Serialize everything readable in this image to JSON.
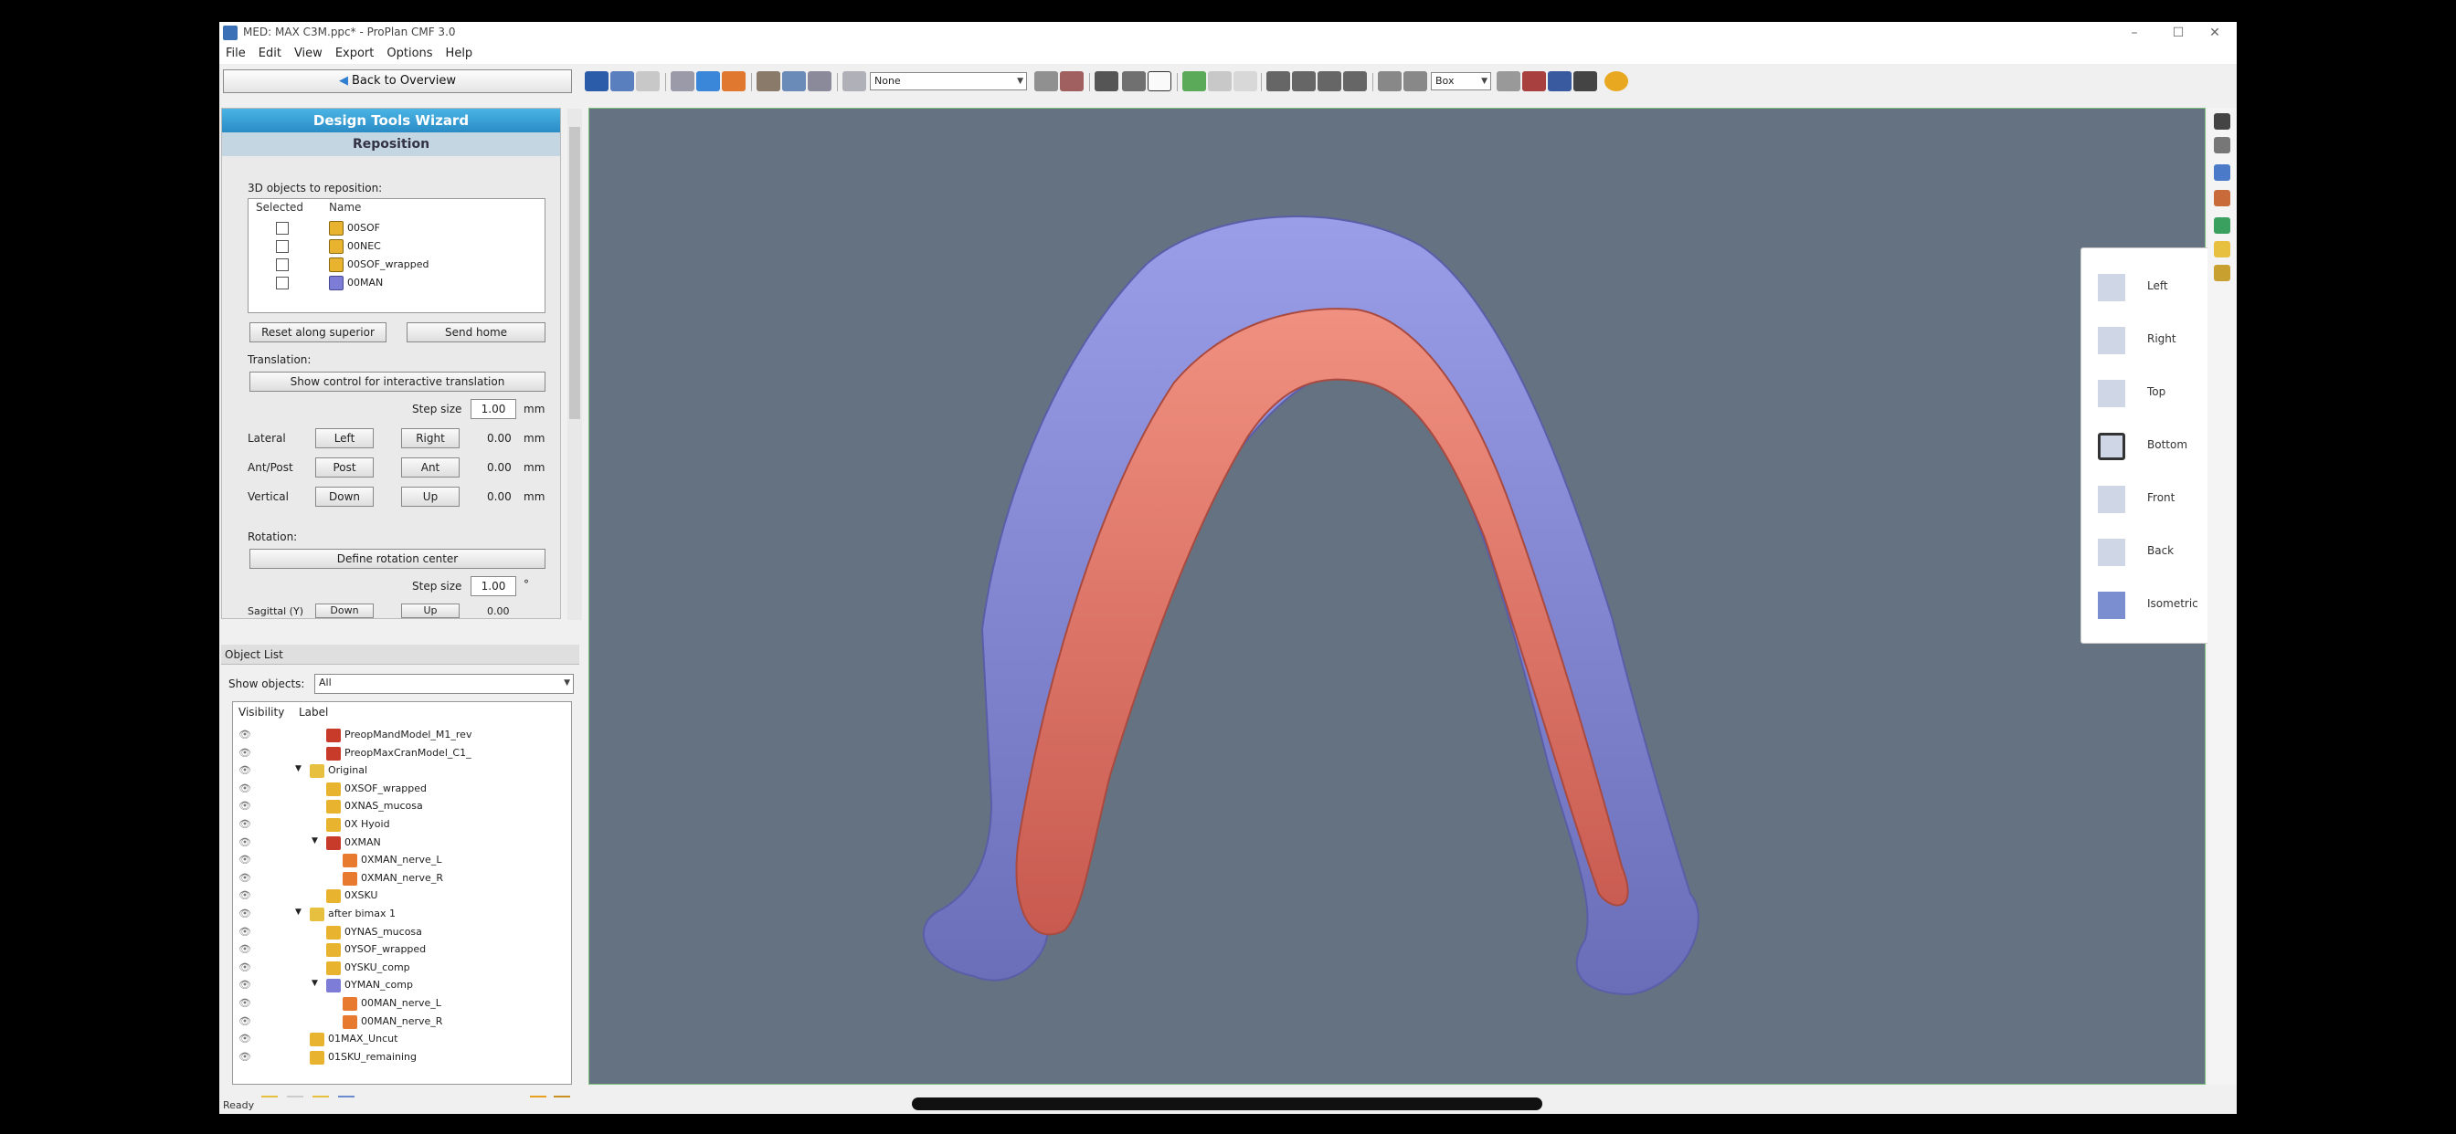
{
  "window": {
    "title": "MED: MAX C3M.ppc* - ProPlan CMF 3.0"
  },
  "menu": [
    "File",
    "Edit",
    "View",
    "Export",
    "Options",
    "Help"
  ],
  "back_button": "Back to Overview",
  "toolbar": {
    "combo_none": "None",
    "combo_box": "Box"
  },
  "wizard": {
    "title": "Design Tools Wizard",
    "subtitle": "Reposition",
    "objects_label": "3D objects to reposition:",
    "col_selected": "Selected",
    "col_name": "Name",
    "objects": [
      "00SOF",
      "00NEC",
      "00SOF_wrapped",
      "00MAN"
    ],
    "reset_button": "Reset along superior",
    "send_home_button": "Send home",
    "translation_label": "Translation:",
    "show_control_button": "Show control for interactive translation",
    "step_label": "Step size",
    "step_value": "1.00",
    "unit_mm": "mm",
    "rows": [
      {
        "label": "Lateral",
        "b1": "Left",
        "b2": "Right",
        "val": "0.00"
      },
      {
        "label": "Ant/Post",
        "b1": "Post",
        "b2": "Ant",
        "val": "0.00"
      },
      {
        "label": "Vertical",
        "b1": "Down",
        "b2": "Up",
        "val": "0.00"
      }
    ],
    "rotation_label": "Rotation:",
    "define_center_button": "Define rotation center",
    "rot_step_value": "1.00",
    "unit_deg": "°",
    "cut_label": "Sagittal (Y)",
    "cut_b1": "Down",
    "cut_b2": "Up",
    "cut_val": "0.00"
  },
  "object_list": {
    "title": "Object List",
    "show_label": "Show objects:",
    "show_value": "All",
    "col_visibility": "Visibility",
    "col_label": "Label",
    "items": [
      {
        "label": "PreopMandModel_M1_rev",
        "color": "#c83a2a",
        "indent": 2
      },
      {
        "label": "PreopMaxCranModel_C1_",
        "color": "#c83a2a",
        "indent": 2
      },
      {
        "label": "Original",
        "color": "#e8c040",
        "indent": 1,
        "folder": true
      },
      {
        "label": "0XSOF_wrapped",
        "color": "#e8b430",
        "indent": 2
      },
      {
        "label": "0XNAS_mucosa",
        "color": "#e8b430",
        "indent": 2
      },
      {
        "label": "0X Hyoid",
        "color": "#e8b430",
        "indent": 2
      },
      {
        "label": "0XMAN",
        "color": "#c83a2a",
        "indent": 2,
        "expanded": true
      },
      {
        "label": "0XMAN_nerve_L",
        "color": "#e87a30",
        "indent": 3
      },
      {
        "label": "0XMAN_nerve_R",
        "color": "#e87a30",
        "indent": 3
      },
      {
        "label": "0XSKU",
        "color": "#e8b430",
        "indent": 2
      },
      {
        "label": "after bimax 1",
        "color": "#e8c040",
        "indent": 1,
        "folder": true
      },
      {
        "label": "0YNAS_mucosa",
        "color": "#e8b430",
        "indent": 2
      },
      {
        "label": "0YSOF_wrapped",
        "color": "#e8b430",
        "indent": 2
      },
      {
        "label": "0YSKU_comp",
        "color": "#e8b430",
        "indent": 2
      },
      {
        "label": "0YMAN_comp",
        "color": "#7d7dd8",
        "indent": 2,
        "expanded": true
      },
      {
        "label": "00MAN_nerve_L",
        "color": "#e87a30",
        "indent": 3
      },
      {
        "label": "00MAN_nerve_R",
        "color": "#e87a30",
        "indent": 3
      },
      {
        "label": "01MAX_Uncut",
        "color": "#e8b430",
        "indent": 1
      },
      {
        "label": "01SKU_remaining",
        "color": "#e8b430",
        "indent": 1
      }
    ]
  },
  "view_panel": [
    "Left",
    "Right",
    "Top",
    "Bottom",
    "Front",
    "Back",
    "Isometric"
  ],
  "status": "Ready"
}
